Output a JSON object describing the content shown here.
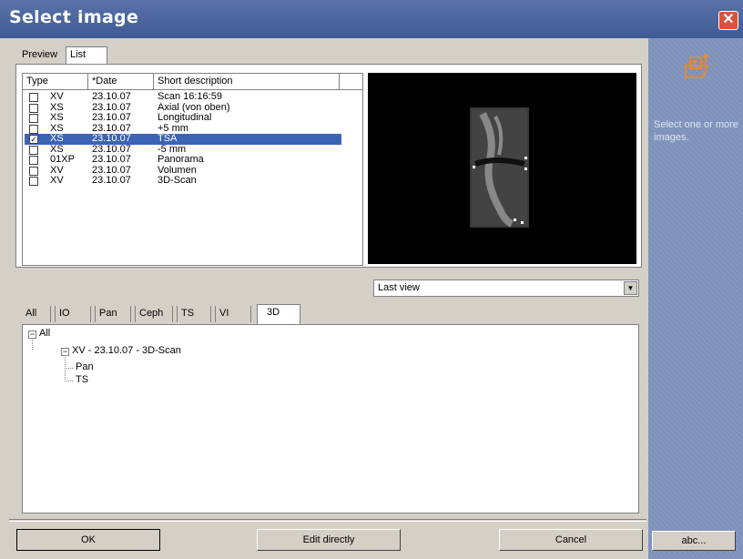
{
  "window": {
    "title": "Select image",
    "close_icon": "close-icon"
  },
  "top_tabs": [
    {
      "label": "Preview",
      "active": false
    },
    {
      "label": "List",
      "active": true
    }
  ],
  "image_list": {
    "columns": [
      "Type",
      "*Date",
      "Short description"
    ],
    "rows": [
      {
        "checked": false,
        "type": "XV",
        "date": "23.10.07",
        "description": "Scan 16:16:59",
        "selected": false
      },
      {
        "checked": false,
        "type": "XS",
        "date": "23.10.07",
        "description": "Axial (von oben)",
        "selected": false
      },
      {
        "checked": false,
        "type": "XS",
        "date": "23.10.07",
        "description": "Longitudinal",
        "selected": false
      },
      {
        "checked": false,
        "type": "XS",
        "date": "23.10.07",
        "description": "+5 mm",
        "selected": false
      },
      {
        "checked": true,
        "type": "XS",
        "date": "23.10.07",
        "description": "TSA",
        "selected": true
      },
      {
        "checked": false,
        "type": "XS",
        "date": "23.10.07",
        "description": "-5 mm",
        "selected": false
      },
      {
        "checked": false,
        "type": "01XP",
        "date": "23.10.07",
        "description": "Panorama",
        "selected": false
      },
      {
        "checked": false,
        "type": "XV",
        "date": "23.10.07",
        "description": "Volumen",
        "selected": false
      },
      {
        "checked": false,
        "type": "XV",
        "date": "23.10.07",
        "description": "3D-Scan",
        "selected": false
      }
    ]
  },
  "view_select": {
    "value": "Last view"
  },
  "filter_tabs": [
    {
      "label": "All"
    },
    {
      "label": "IO"
    },
    {
      "label": "Pan"
    },
    {
      "label": "Ceph"
    },
    {
      "label": "TS"
    },
    {
      "label": "VI"
    },
    {
      "label": "3D",
      "active": true
    }
  ],
  "tree": {
    "root": "All",
    "child": "XV - 23.10.07 - 3D-Scan",
    "leaves": [
      "Pan",
      "TS"
    ]
  },
  "buttons": {
    "ok": "OK",
    "edit": "Edit directly",
    "cancel": "Cancel"
  },
  "sidebar": {
    "icon": "image-folder-icon",
    "hint": "Select one or more images.",
    "abc_button": "abc..."
  },
  "colors": {
    "title_bar": "#3f5a94",
    "selection": "#3c64b4",
    "sidebar": "#7d91ba"
  }
}
